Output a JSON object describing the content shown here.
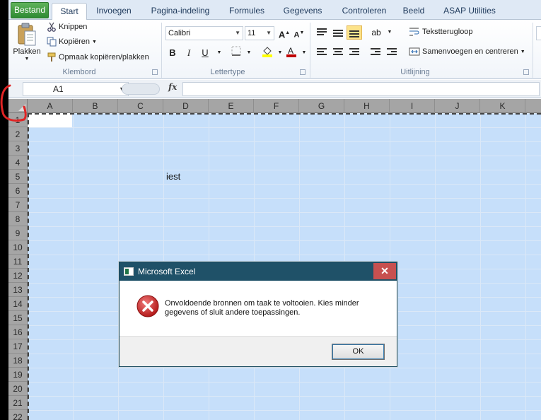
{
  "tabs": [
    {
      "label": "Bestand"
    },
    {
      "label": "Start"
    },
    {
      "label": "Invoegen"
    },
    {
      "label": "Pagina-indeling"
    },
    {
      "label": "Formules"
    },
    {
      "label": "Gegevens"
    },
    {
      "label": "Controleren"
    },
    {
      "label": "Beeld"
    },
    {
      "label": "ASAP Utilities"
    }
  ],
  "ribbon": {
    "clipboard": {
      "paste": "Plakken",
      "cut": "Knippen",
      "copy": "Kopiëren",
      "format_painter": "Opmaak kopiëren/plakken",
      "group_label": "Klembord"
    },
    "font": {
      "font_name": "Calibri",
      "font_size": "11",
      "bold": "B",
      "italic": "I",
      "underline": "U",
      "group_label": "Lettertype",
      "fill_color": "#ffff00",
      "font_color": "#c00000"
    },
    "alignment": {
      "wrap_text": "Tekstterugloop",
      "merge_center": "Samenvoegen en centreren",
      "group_label": "Uitlijning"
    }
  },
  "formula_bar": {
    "name_box": "A1",
    "fx_label": "fx",
    "value": ""
  },
  "sheet": {
    "columns": [
      "A",
      "B",
      "C",
      "D",
      "E",
      "F",
      "G",
      "H",
      "I",
      "J",
      "K"
    ],
    "rows": [
      "1",
      "2",
      "3",
      "4",
      "5",
      "6",
      "7",
      "8",
      "9",
      "10",
      "11",
      "12",
      "13",
      "14",
      "15",
      "16",
      "17",
      "18",
      "19",
      "20",
      "21",
      "22"
    ],
    "cells": {
      "D5": "iest"
    }
  },
  "dialog": {
    "title": "Microsoft Excel",
    "close": "✕",
    "message": "Onvoldoende bronnen om taak te voltooien. Kies minder gegevens of sluit andere toepassingen.",
    "ok": "OK"
  }
}
